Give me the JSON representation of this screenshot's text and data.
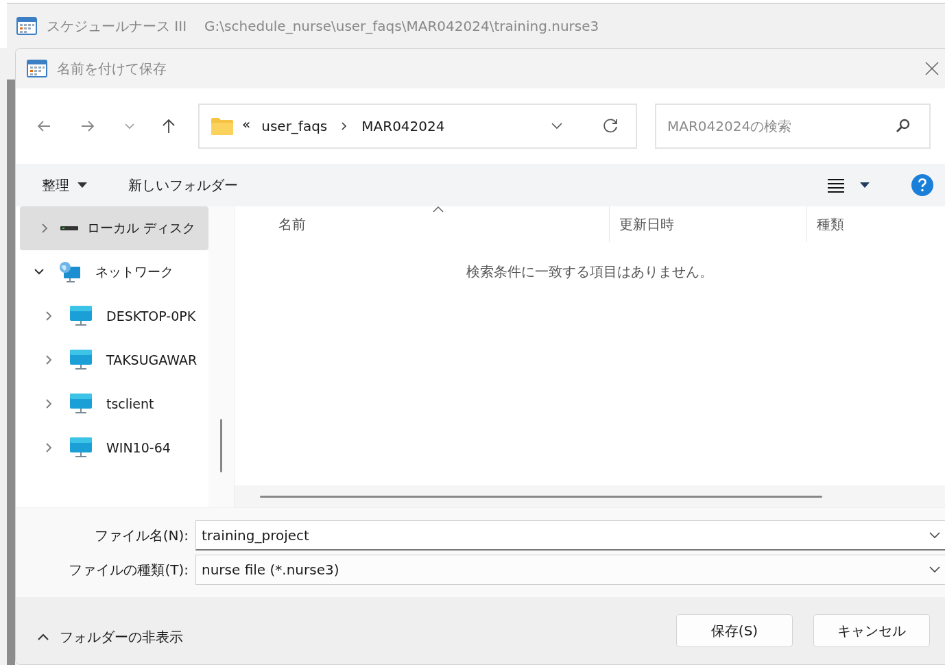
{
  "app_window": {
    "title": "スケジュールナース III",
    "path": "G:\\schedule_nurse\\user_faqs\\MAR042024\\training.nurse3"
  },
  "dialog": {
    "title": "名前を付けて保存"
  },
  "address_bar": {
    "overflow": "«",
    "segments": [
      "user_faqs",
      "MAR042024"
    ]
  },
  "search": {
    "placeholder": "MAR042024の検索"
  },
  "toolbar": {
    "organize": "整理",
    "new_folder": "新しいフォルダー"
  },
  "navigation": [
    {
      "label": "ローカル ディスク",
      "kind": "drive",
      "selected": true,
      "expanded": false
    },
    {
      "label": "ネットワーク",
      "kind": "network",
      "selected": false,
      "expanded": true,
      "children": [
        {
          "label": "DESKTOP-0PK",
          "kind": "computer",
          "selected": false,
          "expanded": false
        },
        {
          "label": "TAKSUGAWAR",
          "kind": "computer",
          "selected": false,
          "expanded": false
        },
        {
          "label": "tsclient",
          "kind": "computer",
          "selected": false,
          "expanded": false
        },
        {
          "label": "WIN10-64",
          "kind": "computer",
          "selected": false,
          "expanded": false
        }
      ]
    }
  ],
  "file_list": {
    "columns": [
      {
        "label": "名前",
        "sorted": true
      },
      {
        "label": "更新日時",
        "sorted": false
      },
      {
        "label": "種類",
        "sorted": false
      }
    ],
    "empty_message": "検索条件に一致する項目はありません。"
  },
  "filename": {
    "label": "ファイル名(N):",
    "value": "training_project"
  },
  "filetype": {
    "label": "ファイルの種類(T):",
    "value": "nurse file (*.nurse3)"
  },
  "hide_folders": {
    "label": "フォルダーの非表示"
  },
  "buttons": [
    {
      "label": "保存(S)"
    },
    {
      "label": "キャンセル"
    }
  ]
}
